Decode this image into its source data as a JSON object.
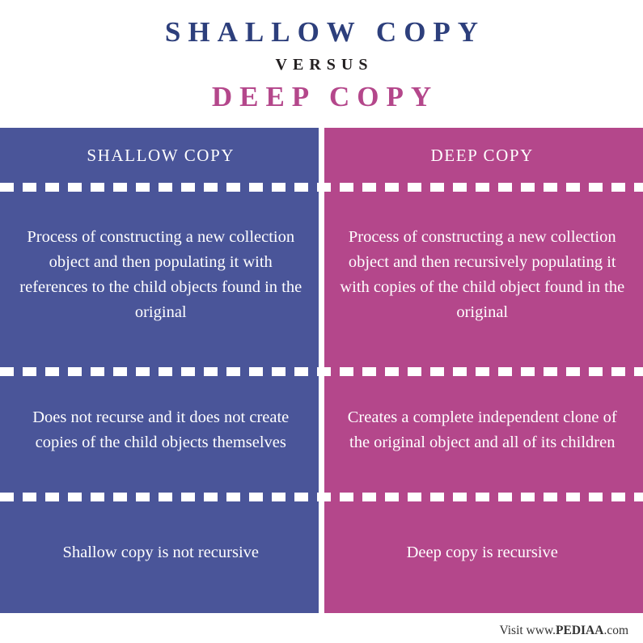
{
  "header": {
    "title_main": "SHALLOW COPY",
    "versus": "VERSUS",
    "title_second": "DEEP COPY"
  },
  "colors": {
    "shallow": "#4a5599",
    "deep": "#b4478b",
    "title_main": "#2d3f7c",
    "title_second": "#b4478b",
    "versus": "#231f20",
    "text": "#ffffff",
    "background": "#ffffff"
  },
  "table": {
    "columns": [
      {
        "header": "SHALLOW COPY",
        "rows": [
          "Process of constructing a new collection object and then populating it with references to the child objects found in the original",
          "Does not recurse and it does not create copies of the child objects themselves",
          "Shallow copy is not recursive"
        ]
      },
      {
        "header": "DEEP COPY",
        "rows": [
          "Process of constructing a new collection object and then recursively populating it with copies of the child object found in the original",
          "Creates a complete independent clone of the original object and all of its children",
          "Deep copy is recursive"
        ]
      }
    ]
  },
  "footer": {
    "prefix": "Visit www.",
    "brand": "PEDIAA",
    "suffix": ".com"
  }
}
